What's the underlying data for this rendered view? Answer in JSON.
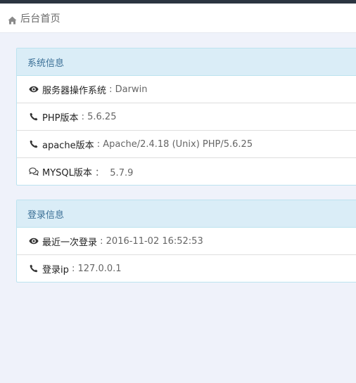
{
  "breadcrumb": {
    "icon": "home-icon",
    "label": "后台首页"
  },
  "system_panel": {
    "title": "系统信息",
    "rows": [
      {
        "icon": "eye-icon",
        "label": "服务器操作系统",
        "value": " : Darwin"
      },
      {
        "icon": "phone-icon",
        "label": "PHP版本",
        "value": " : 5.6.25"
      },
      {
        "icon": "phone-icon",
        "label": "apache版本",
        "value": " : Apache/2.4.18 (Unix) PHP/5.6.25"
      },
      {
        "icon": "comments-icon",
        "label": "MYSQL版本",
        "value": " ：  5.7.9"
      }
    ]
  },
  "login_panel": {
    "title": "登录信息",
    "rows": [
      {
        "icon": "eye-icon",
        "label": "最近一次登录",
        "value": " : 2016-11-02 16:52:53"
      },
      {
        "icon": "phone-icon",
        "label": "登录ip",
        "value": " : 127.0.0.1"
      }
    ]
  },
  "colors": {
    "background": "#eff2fa",
    "topbar": "#2b3541",
    "panel_heading_bg": "#daedf7",
    "panel_border": "#bce3ef",
    "panel_title": "#3a6f96"
  }
}
